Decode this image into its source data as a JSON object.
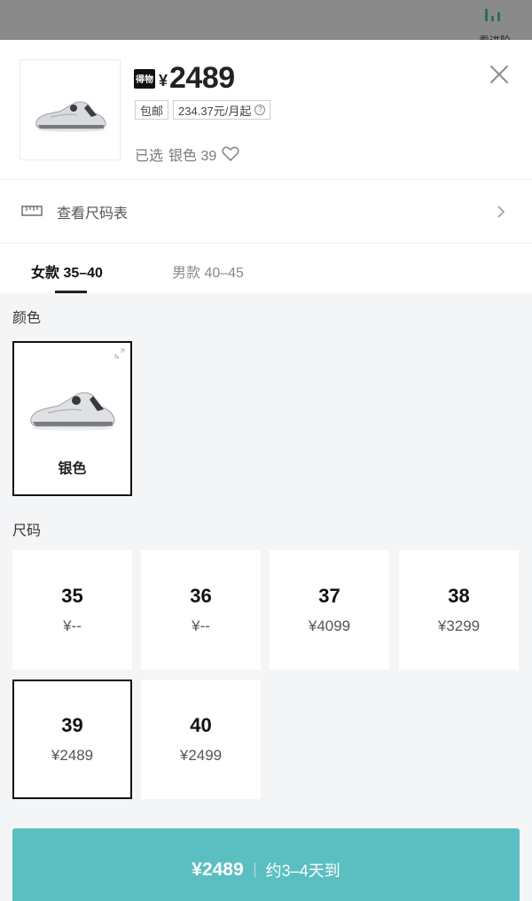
{
  "background_hint": {
    "text": "看进阶"
  },
  "product": {
    "brand_mark": "得物",
    "currency": "¥",
    "price": "2489",
    "tags": {
      "free_shipping": "包邮",
      "installment": "234.37元/月起"
    },
    "selected_prefix": "已选",
    "selected_value": "银色 39"
  },
  "size_chart": {
    "label": "查看尺码表"
  },
  "tabs": [
    {
      "label": "女款 35–40",
      "active": true
    },
    {
      "label": "男款 40–45",
      "active": false
    }
  ],
  "color_section": {
    "title": "颜色",
    "options": [
      {
        "name": "银色",
        "selected": true
      }
    ]
  },
  "size_section": {
    "title": "尺码",
    "options": [
      {
        "size": "35",
        "price": "¥--",
        "selected": false
      },
      {
        "size": "36",
        "price": "¥--",
        "selected": false
      },
      {
        "size": "37",
        "price": "¥4099",
        "selected": false
      },
      {
        "size": "38",
        "price": "¥3299",
        "selected": false
      },
      {
        "size": "39",
        "price": "¥2489",
        "selected": true
      },
      {
        "size": "40",
        "price": "¥2499",
        "selected": false
      }
    ]
  },
  "buy_button": {
    "price": "¥2489",
    "eta": "约3–4天到",
    "color": "#5bbfc1"
  },
  "icons": {
    "close": "close-icon",
    "favorite": "heart-icon",
    "info": "info-icon",
    "ruler": "ruler-icon",
    "chevron": "chevron-right-icon",
    "expand": "expand-icon"
  }
}
